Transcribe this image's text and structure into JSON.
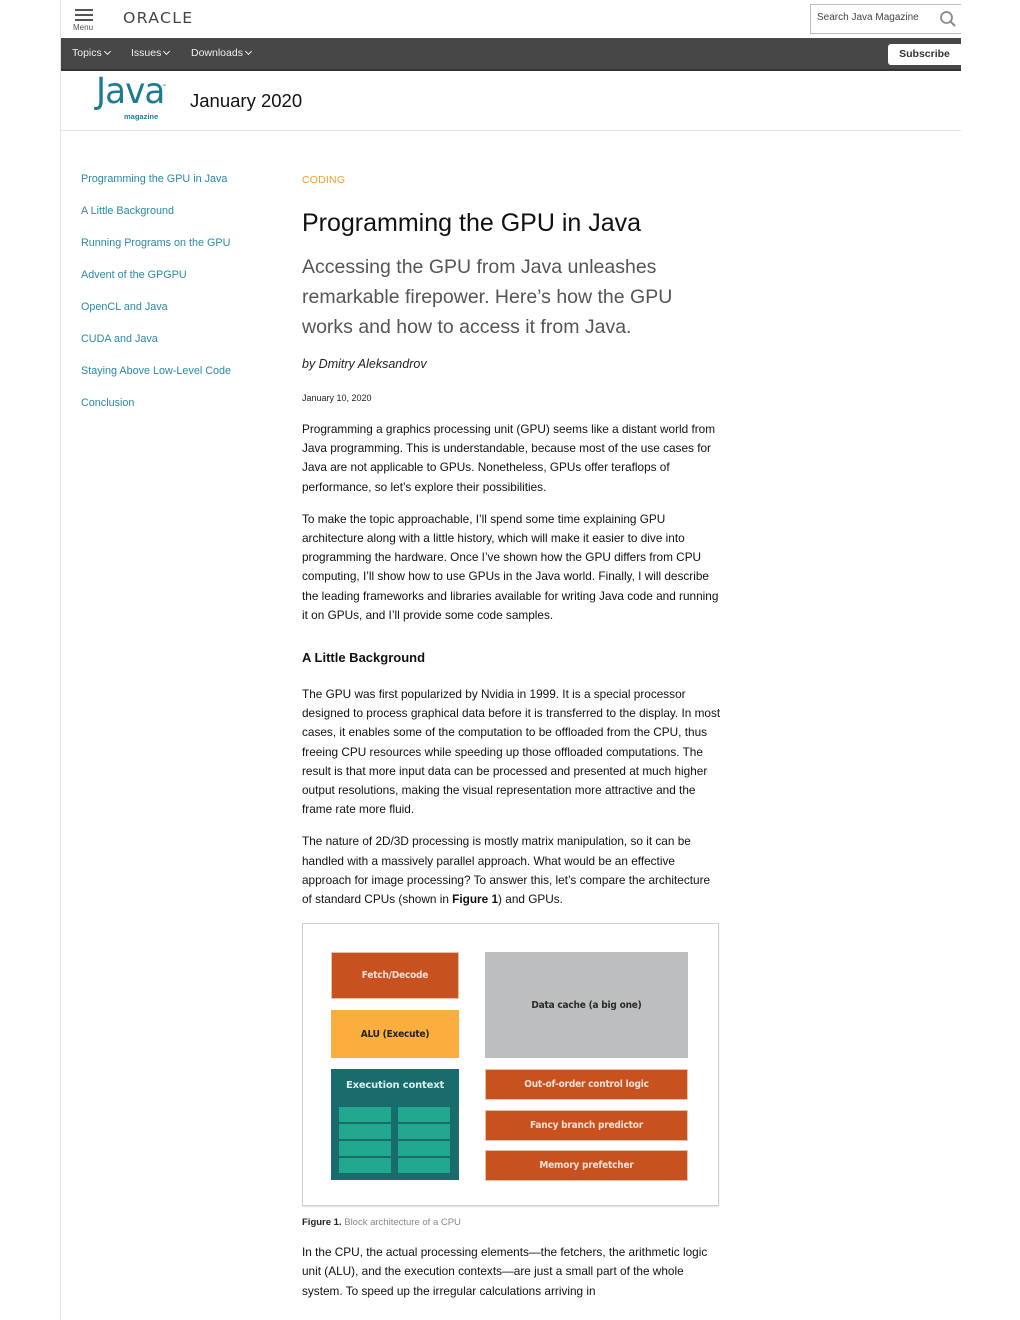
{
  "topbar": {
    "menu_label": "Menu",
    "brand": "ORACLE",
    "search_placeholder": "Search Java Magazine",
    "search_icon": "magnifier-icon"
  },
  "navbar": {
    "items": [
      {
        "label": "Topics",
        "icon": "chevron-down-icon"
      },
      {
        "label": "Issues",
        "icon": "chevron-down-icon"
      },
      {
        "label": "Downloads",
        "icon": "chevron-down-icon"
      }
    ],
    "subscribe_label": "Subscribe"
  },
  "masthead": {
    "logo_word": "Java",
    "logo_tm": "™",
    "logo_sub": "magazine",
    "issue": "January 2020"
  },
  "toc": {
    "items": [
      "Programming the GPU in Java",
      "A Little Background",
      "Running Programs on the GPU",
      "Advent of the GPGPU",
      "OpenCL and Java",
      "CUDA and Java",
      "Staying Above Low-Level Code",
      "Conclusion"
    ]
  },
  "article": {
    "category": "CODING",
    "title": "Programming the GPU in Java",
    "subtitle": "Accessing the GPU from Java unleashes remarkable firepower. Here’s how the GPU works and how to access it from Java.",
    "byline": "by Dmitry Aleksandrov",
    "date": "January 10, 2020",
    "paragraphs": [
      "Programming a graphics processing unit (GPU) seems like a distant world from Java programming. This is understandable, because most of the use cases for Java are not applicable to GPUs. Nonetheless, GPUs offer teraflops of performance, so let’s explore their possibilities.",
      "To make the topic approachable, I’ll spend some time explaining GPU architecture along with a little history, which will make it easier to dive into programming the hardware. Once I’ve shown how the GPU differs from CPU computing, I’ll show how to use GPUs in the Java world. Finally, I will describe the leading frameworks and libraries available for writing Java code and running it on GPUs, and I’ll provide some code samples."
    ],
    "section_heading": "A Little Background",
    "section_paragraphs": [
      "The GPU was first popularized by Nvidia in 1999. It is a special processor designed to process graphical data before it is transferred to the display. In most cases, it enables some of the computation to be offloaded from the CPU, thus freeing CPU resources while speeding up those offloaded computations. The result is that more input data can be processed and presented at much higher output resolutions, making the visual representation more attractive and the frame rate more fluid."
    ],
    "compare_paragraph": {
      "before": "The nature of 2D/3D processing is mostly matrix manipulation, so it can be handled with a massively parallel approach. What would be an effective approach for image processing? To answer this, let’s compare the architecture of standard CPUs (shown in ",
      "bold": "Figure 1",
      "after": ") and GPUs."
    },
    "figure": {
      "blocks": {
        "fetch_decode": "Fetch/Decode",
        "alu": "ALU (Execute)",
        "data_cache": "Data cache (a big one)",
        "execution_context": "Execution context",
        "out_of_order": "Out-of-order control logic",
        "branch_predictor": "Fancy branch predictor",
        "memory_prefetcher": "Memory prefetcher"
      },
      "execution_context_cells": 8,
      "colors": {
        "orange": "#c8521f",
        "yellow": "#f9ae3d",
        "gray": "#bdbebf",
        "teal_dark": "#1a6b6b",
        "teal_light": "#22a88f"
      },
      "caption_label": "Figure 1.",
      "caption_text": "Block architecture of a CPU"
    },
    "closing_paragraph": "In the CPU, the actual processing elements—the fetchers, the arithmetic logic unit (ALU), and the execution contexts—are just a small part of the whole system. To speed up the irregular calculations arriving in"
  },
  "colors": {
    "link": "#2a8aa4",
    "category": "#f0a030",
    "navbar": "#474747",
    "brand_teal": "#1f7a94"
  }
}
